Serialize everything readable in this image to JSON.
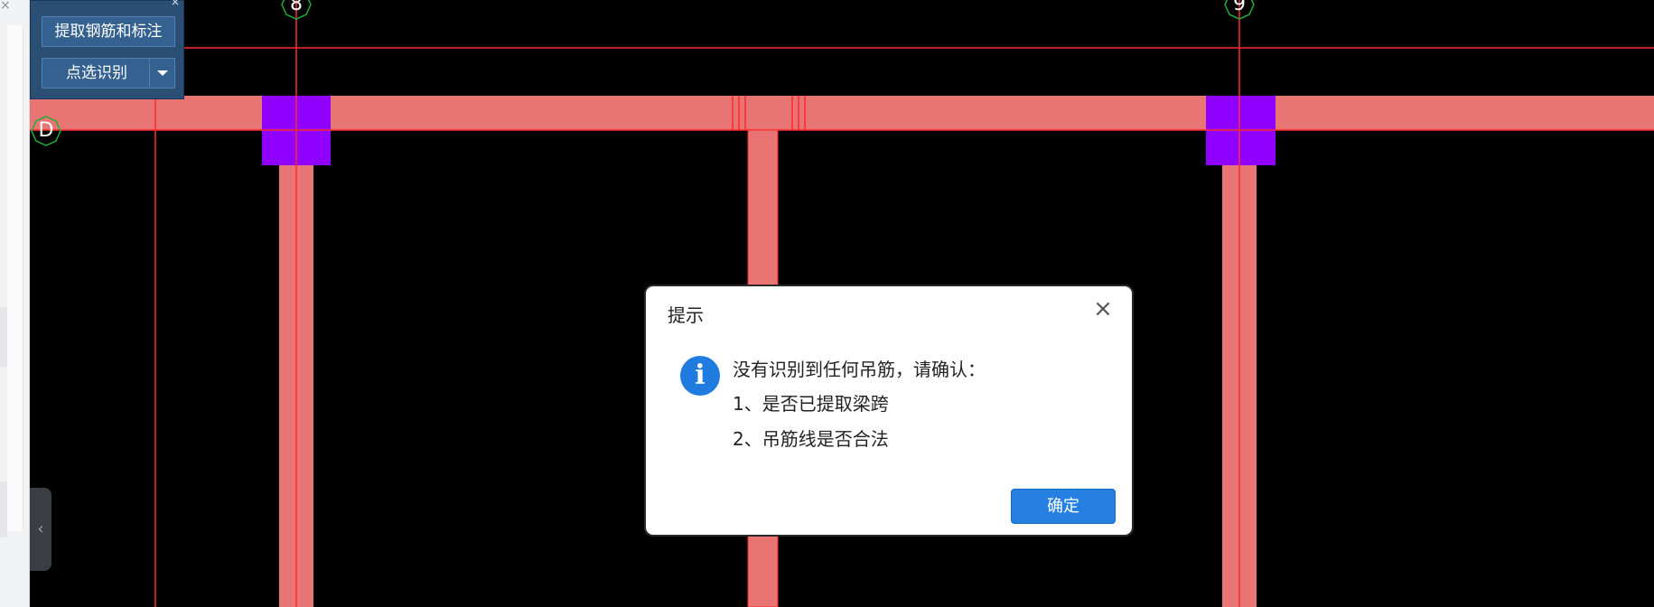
{
  "left_panel": {
    "close_glyph": "×",
    "side_tab_glyph": "‹"
  },
  "tool_panel": {
    "close_glyph": "×",
    "extract_button_label": "提取钢筋和标注",
    "point_select_label": "点选识别"
  },
  "axes": {
    "axis_8": "8",
    "axis_9": "9",
    "axis_d": "D"
  },
  "colors": {
    "beam": "#e97474",
    "column": "#8f00ff",
    "axis_line": "#ff2a2a",
    "bubble": "#1fae3a"
  },
  "dialog": {
    "title": "提示",
    "close_glyph": "×",
    "info_glyph": "i",
    "message_line1": "没有识别到任何吊筋，请确认：",
    "message_line2": "1、是否已提取梁跨",
    "message_line3": "2、吊筋线是否合法",
    "ok_label": "确定"
  }
}
